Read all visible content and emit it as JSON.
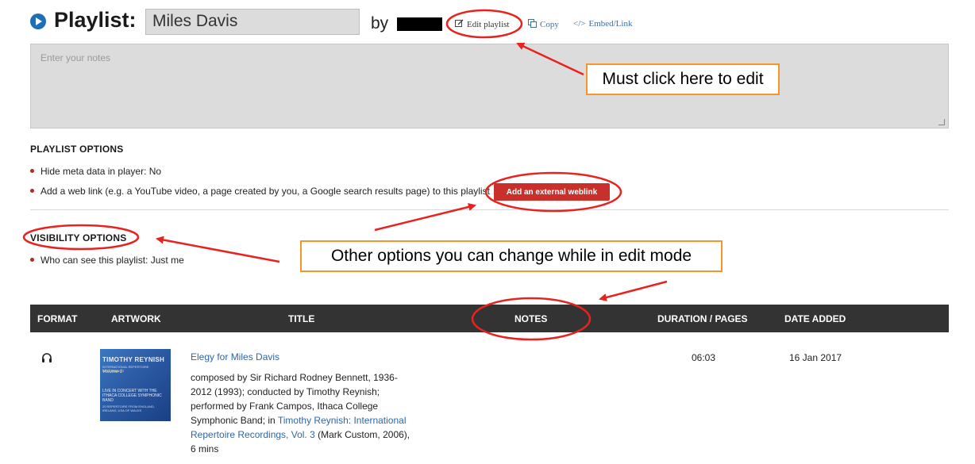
{
  "header": {
    "title": "Playlist:",
    "playlist_name": "Miles Davis",
    "by_label": "by",
    "edit_label": "Edit playlist",
    "copy_label": "Copy",
    "embed_label": "Embed/Link"
  },
  "notes": {
    "placeholder": "Enter your notes"
  },
  "playlist_options": {
    "heading": "PLAYLIST OPTIONS",
    "items": [
      "Hide meta data in player: No",
      "Add a web link (e.g. a YouTube video, a page created by you, a Google search results page) to this playlist"
    ],
    "weblink_button": "Add an external weblink"
  },
  "visibility_options": {
    "heading": "VISIBILITY OPTIONS",
    "items": [
      "Who can see this playlist: Just me"
    ]
  },
  "table": {
    "columns": [
      "FORMAT",
      "ARTWORK",
      "TITLE",
      "NOTES",
      "DURATION / PAGES",
      "DATE ADDED"
    ],
    "rows": [
      {
        "format_icon": "headphones-icon",
        "artwork": {
          "title": "TIMOTHY REYNISH",
          "subtitle": "INTERNATIONAL REPERTOIRE RECORDINGS",
          "volume": "Volume 1",
          "live_line": "LIVE IN CONCERT WITH THE ITHACA COLLEGE SYMPHONIC BAND",
          "bottom_line": "20 REPERTOIRE FROM ENGLAND, IRELAND, USA OF WALES"
        },
        "title": "Elegy for Miles Davis",
        "desc_pre": "composed by Sir Richard Rodney Bennett, 1936-2012 (1993); conducted by Timothy Reynish; performed by Frank Campos, Ithaca College Symphonic Band; in ",
        "desc_link": "Timothy Reynish: International Repertoire Recordings, Vol. 3",
        "desc_post": " (Mark Custom, 2006), 6 mins",
        "duration": "06:03",
        "date_added": "16 Jan 2017"
      }
    ]
  },
  "annotations": {
    "callout_edit": "Must click here to edit",
    "callout_options": "Other options you can change while in edit mode",
    "circle_color": "#e8231f",
    "arrow_color": "#e8231f",
    "box_color": "#f5952b"
  }
}
